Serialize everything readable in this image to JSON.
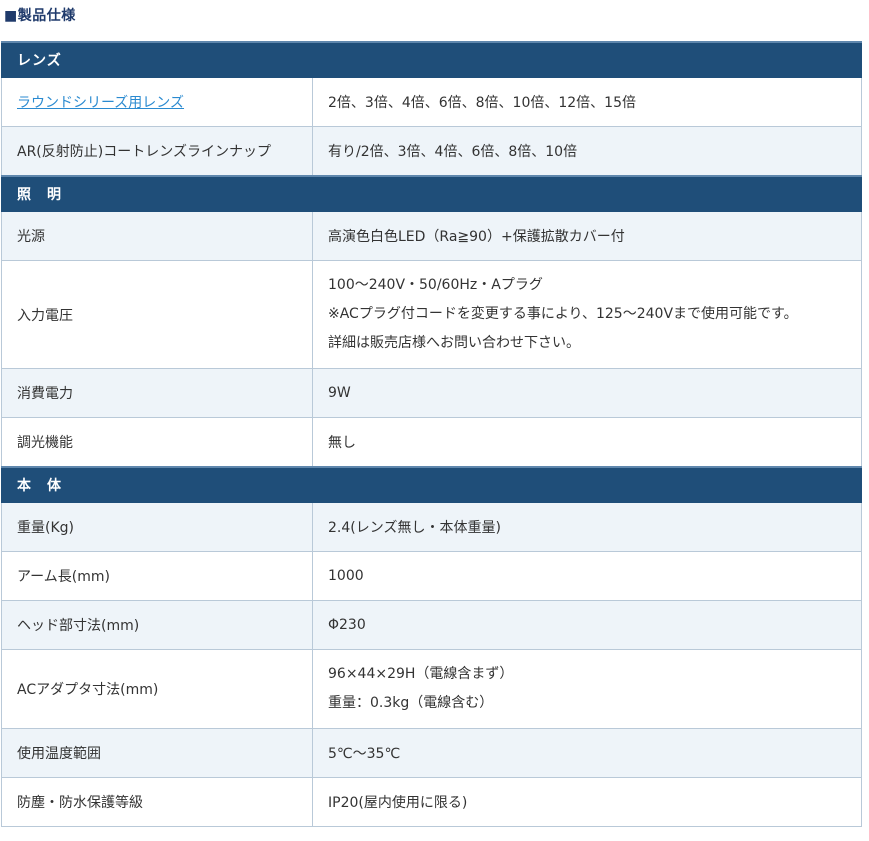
{
  "page": {
    "title": "■製品仕様"
  },
  "sections": {
    "lens": {
      "header": "レンズ",
      "rows": [
        {
          "label": "ラウンドシリーズ用レンズ",
          "value": "2倍、3倍、4倍、6倍、8倍、10倍、12倍、15倍"
        },
        {
          "label": "AR(反射防止)コートレンズラインナップ",
          "value": "有り/2倍、3倍、4倍、6倍、8倍、10倍"
        }
      ]
    },
    "lighting": {
      "header": "照　明",
      "rows": [
        {
          "label": "光源",
          "value": "高演色白色LED（Ra≧90）+保護拡散カバー付"
        },
        {
          "label": "入力電圧",
          "lines": [
            "100～240V・50/60Hz・Aプラグ",
            "※ACプラグ付コードを変更する事により、125～240Vまで使用可能です。",
            "詳細は販売店様へお問い合わせ下さい。"
          ]
        },
        {
          "label": "消費電力",
          "value": "9W"
        },
        {
          "label": "調光機能",
          "value": "無し"
        }
      ]
    },
    "body": {
      "header": "本　体",
      "rows": [
        {
          "label": "重量(Kg)",
          "value": "2.4(レンズ無し・本体重量)"
        },
        {
          "label": "アーム長(mm)",
          "value": "1000"
        },
        {
          "label": "ヘッド部寸法(mm)",
          "value": "Φ230"
        },
        {
          "label": "ACアダプタ寸法(mm)",
          "lines": [
            "96×44×29H（電線含まず）",
            "重量：0.3kg（電線含む）"
          ]
        },
        {
          "label": "使用温度範囲",
          "value": "5℃～35℃"
        },
        {
          "label": "防塵・防水保護等級",
          "value": "IP20(屋内使用に限る)"
        }
      ]
    }
  }
}
